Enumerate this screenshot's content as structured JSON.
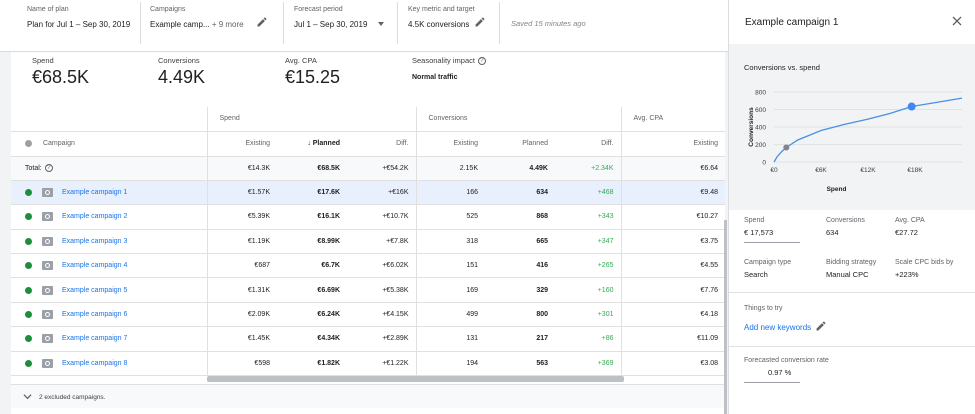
{
  "topbar": {
    "plan_name": {
      "label": "Name of plan",
      "value": "Plan for Jul 1 – Sep 30, 2019"
    },
    "campaigns": {
      "label": "Campaigns",
      "value": "Example camp...",
      "more": "+ 9 more"
    },
    "forecast": {
      "label": "Forecast period",
      "value": "Jul 1 – Sep 30, 2019"
    },
    "metric": {
      "label": "Key metric and target",
      "value": "4.5K conversions"
    },
    "saved": "Saved 15 minutes ago"
  },
  "summary": {
    "spend": {
      "label": "Spend",
      "value": "€68.5K"
    },
    "conversions": {
      "label": "Conversions",
      "value": "4.49K"
    },
    "avg_cpa": {
      "label": "Avg. CPA",
      "value": "€15.25"
    },
    "seasonality": {
      "label": "Seasonality impact",
      "value": "Normal traffic"
    }
  },
  "table": {
    "groups": {
      "spend": "Spend",
      "conversions": "Conversions",
      "avg_cpa": "Avg. CPA"
    },
    "headers": {
      "campaign": "Campaign",
      "existing": "Existing",
      "planned": "Planned",
      "diff": "Diff."
    },
    "sort_arrow": "↓",
    "total": {
      "label": "Total:",
      "spend_existing": "€14.3K",
      "spend_planned": "€68.5K",
      "spend_diff": "+€54.2K",
      "conv_existing": "2.15K",
      "conv_planned": "4.49K",
      "conv_diff": "+2.34K",
      "cpa_existing": "€6.64"
    },
    "rows": [
      {
        "name": "Example campaign 1",
        "spend_existing": "€1.57K",
        "spend_planned": "€17.6K",
        "spend_diff": "+€16K",
        "conv_existing": "166",
        "conv_planned": "634",
        "conv_diff": "+468",
        "cpa_existing": "€9.48"
      },
      {
        "name": "Example campaign 2",
        "spend_existing": "€5.39K",
        "spend_planned": "€16.1K",
        "spend_diff": "+€10.7K",
        "conv_existing": "525",
        "conv_planned": "868",
        "conv_diff": "+343",
        "cpa_existing": "€10.27"
      },
      {
        "name": "Example campaign 3",
        "spend_existing": "€1.19K",
        "spend_planned": "€8.99K",
        "spend_diff": "+€7.8K",
        "conv_existing": "318",
        "conv_planned": "665",
        "conv_diff": "+347",
        "cpa_existing": "€3.75"
      },
      {
        "name": "Example campaign 4",
        "spend_existing": "€687",
        "spend_planned": "€6.7K",
        "spend_diff": "+€6.02K",
        "conv_existing": "151",
        "conv_planned": "416",
        "conv_diff": "+265",
        "cpa_existing": "€4.55"
      },
      {
        "name": "Example campaign 5",
        "spend_existing": "€1.31K",
        "spend_planned": "€6.69K",
        "spend_diff": "+€5.38K",
        "conv_existing": "169",
        "conv_planned": "329",
        "conv_diff": "+160",
        "cpa_existing": "€7.76"
      },
      {
        "name": "Example campaign 6",
        "spend_existing": "€2.09K",
        "spend_planned": "€6.24K",
        "spend_diff": "+€4.15K",
        "conv_existing": "499",
        "conv_planned": "800",
        "conv_diff": "+301",
        "cpa_existing": "€4.18"
      },
      {
        "name": "Example campaign 7",
        "spend_existing": "€1.45K",
        "spend_planned": "€4.34K",
        "spend_diff": "+€2.89K",
        "conv_existing": "131",
        "conv_planned": "217",
        "conv_diff": "+86",
        "cpa_existing": "€11.09"
      },
      {
        "name": "Example campaign 8",
        "spend_existing": "€598",
        "spend_planned": "€1.82K",
        "spend_diff": "+€1.22K",
        "conv_existing": "194",
        "conv_planned": "563",
        "conv_diff": "+369",
        "cpa_existing": "€3.08"
      }
    ],
    "excluded": "2 excluded campaigns."
  },
  "panel": {
    "title": "Example campaign 1",
    "chart_title": "Conversions vs. spend",
    "spend": {
      "label": "Spend",
      "value": "€ 17,573"
    },
    "conversions": {
      "label": "Conversions",
      "value": "634"
    },
    "avg_cpa": {
      "label": "Avg. CPA",
      "value": "€27.72"
    },
    "campaign_type": {
      "label": "Campaign type",
      "value": "Search"
    },
    "bidding": {
      "label": "Bidding strategy",
      "value": "Manual CPC"
    },
    "scale_cpc": {
      "label": "Scale CPC bids by",
      "value": "+223%"
    },
    "things_to_try": "Things to try",
    "add_keywords": "Add new keywords",
    "conv_rate": {
      "label": "Forecasted conversion rate",
      "value": "0.97 %"
    }
  },
  "chart_data": {
    "type": "line",
    "xlabel": "Spend",
    "ylabel": "Conversions",
    "x_ticks": [
      "€0",
      "€6K",
      "€12K",
      "€18K"
    ],
    "y_ticks": [
      "0",
      "200",
      "400",
      "600",
      "800"
    ],
    "xlim": [
      0,
      24000
    ],
    "ylim": [
      0,
      800
    ],
    "series": [
      {
        "x": [
          0,
          400,
          1000,
          1570,
          3000,
          6000,
          9000,
          12000,
          15000,
          17573,
          20000,
          24000
        ],
        "y": [
          0,
          60,
          120,
          166,
          250,
          360,
          430,
          490,
          560,
          634,
          670,
          730
        ]
      }
    ],
    "points": [
      {
        "x": 1570,
        "y": 166,
        "color": "#80868b"
      },
      {
        "x": 17573,
        "y": 634,
        "color": "#4285f4"
      }
    ],
    "line_color": "#4a90e2"
  }
}
